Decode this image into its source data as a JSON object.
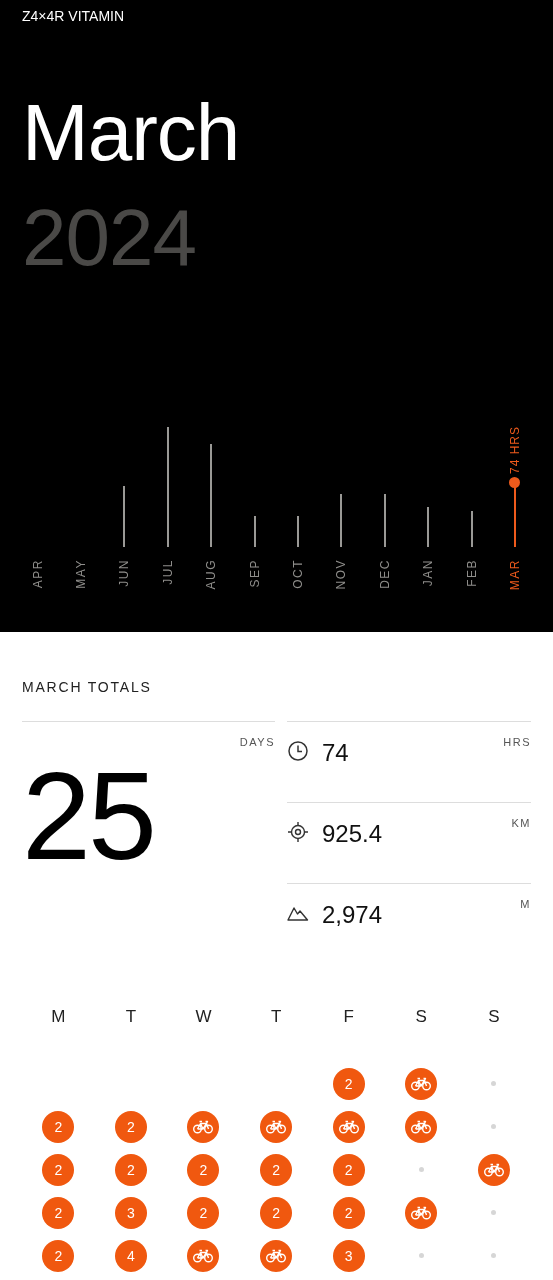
{
  "header": {
    "brand": "Z4×4R VITAMIN",
    "month": "March",
    "year": "2024"
  },
  "monthly_chart": {
    "months": [
      {
        "label": "APR",
        "selected": false
      },
      {
        "label": "MAY",
        "selected": false
      },
      {
        "label": "JUN",
        "selected": false
      },
      {
        "label": "JUL",
        "selected": false
      },
      {
        "label": "AUG",
        "selected": false
      },
      {
        "label": "SEP",
        "selected": false
      },
      {
        "label": "OCT",
        "selected": false
      },
      {
        "label": "NOV",
        "selected": false
      },
      {
        "label": "DEC",
        "selected": false
      },
      {
        "label": "JAN",
        "selected": false
      },
      {
        "label": "FEB",
        "selected": false
      },
      {
        "label": "MAR",
        "selected": true,
        "reading": "74 HRS"
      }
    ]
  },
  "totals": {
    "title": "MARCH TOTALS",
    "days": {
      "value": "25",
      "unit": "DAYS"
    },
    "stats": [
      {
        "kind": "time",
        "value": "74",
        "unit": "HRS"
      },
      {
        "kind": "distance",
        "value": "925.4",
        "unit": "KM"
      },
      {
        "kind": "elevation",
        "value": "2,974",
        "unit": "M"
      }
    ]
  },
  "calendar": {
    "weekdays": [
      "M",
      "T",
      "W",
      "T",
      "F",
      "S",
      "S"
    ],
    "weeks": [
      [
        {
          "kind": "empty"
        },
        {
          "kind": "empty"
        },
        {
          "kind": "empty"
        },
        {
          "kind": "empty"
        },
        {
          "kind": "count",
          "label": "2"
        },
        {
          "kind": "bike"
        },
        {
          "kind": "rest"
        }
      ],
      [
        {
          "kind": "count",
          "label": "2"
        },
        {
          "kind": "count",
          "label": "2"
        },
        {
          "kind": "bike"
        },
        {
          "kind": "bike"
        },
        {
          "kind": "bike"
        },
        {
          "kind": "bike"
        },
        {
          "kind": "rest"
        }
      ],
      [
        {
          "kind": "count",
          "label": "2"
        },
        {
          "kind": "count",
          "label": "2"
        },
        {
          "kind": "count",
          "label": "2"
        },
        {
          "kind": "count",
          "label": "2"
        },
        {
          "kind": "count",
          "label": "2"
        },
        {
          "kind": "rest"
        },
        {
          "kind": "bike"
        }
      ],
      [
        {
          "kind": "count",
          "label": "2"
        },
        {
          "kind": "count",
          "label": "3"
        },
        {
          "kind": "count",
          "label": "2"
        },
        {
          "kind": "count",
          "label": "2"
        },
        {
          "kind": "count",
          "label": "2"
        },
        {
          "kind": "bike"
        },
        {
          "kind": "rest"
        }
      ],
      [
        {
          "kind": "count",
          "label": "2"
        },
        {
          "kind": "count",
          "label": "4"
        },
        {
          "kind": "bike"
        },
        {
          "kind": "bike"
        },
        {
          "kind": "count",
          "label": "3"
        },
        {
          "kind": "rest"
        },
        {
          "kind": "rest"
        }
      ]
    ]
  }
}
